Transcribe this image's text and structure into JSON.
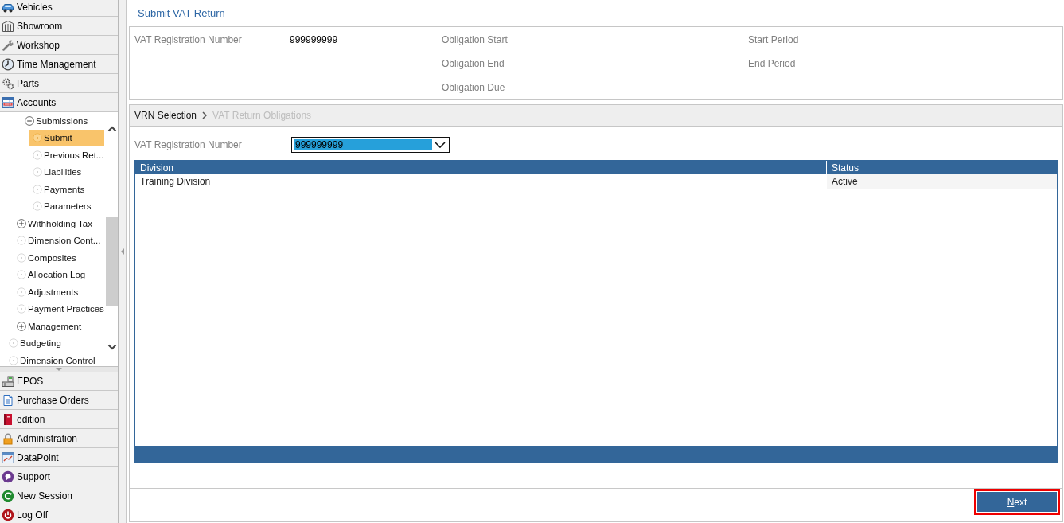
{
  "sidebar": {
    "top_items": [
      {
        "label": "Vehicles"
      },
      {
        "label": "Showroom"
      },
      {
        "label": "Workshop"
      },
      {
        "label": "Time Management"
      },
      {
        "label": "Parts"
      },
      {
        "label": "Accounts"
      }
    ],
    "tree": [
      {
        "children": [
          {
            "children": [
              {
                "label": "Submissions",
                "kind": "group",
                "expanded": true,
                "selected": false,
                "children": [
                  {
                    "label": "Submit",
                    "kind": "leaf",
                    "selected": true
                  },
                  {
                    "label": "Previous Ret...",
                    "kind": "leaf",
                    "selected": false
                  },
                  {
                    "label": "Liabilities",
                    "kind": "leaf",
                    "selected": false
                  },
                  {
                    "label": "Payments",
                    "kind": "leaf",
                    "selected": false
                  },
                  {
                    "label": "Parameters",
                    "kind": "leaf",
                    "selected": false
                  }
                ]
              }
            ]
          },
          {
            "label": "Withholding Tax",
            "kind": "group",
            "expanded": false,
            "selected": false
          },
          {
            "label": "Dimension Cont...",
            "kind": "leaf",
            "selected": false
          },
          {
            "label": "Composites",
            "kind": "leaf",
            "selected": false
          },
          {
            "label": "Allocation Log",
            "kind": "leaf",
            "selected": false
          },
          {
            "label": "Adjustments",
            "kind": "leaf",
            "selected": false
          },
          {
            "label": "Payment Practices",
            "kind": "leaf",
            "selected": false
          },
          {
            "label": "Management",
            "kind": "group",
            "expanded": false,
            "selected": false
          }
        ]
      },
      {
        "label": "Budgeting",
        "kind": "leaf",
        "selected": false
      },
      {
        "label": "Dimension Control",
        "kind": "leaf",
        "selected": false
      }
    ],
    "bottom_items": [
      {
        "label": "EPOS"
      },
      {
        "label": "Purchase Orders"
      },
      {
        "label": "edition"
      },
      {
        "label": "Administration"
      },
      {
        "label": "DataPoint"
      },
      {
        "label": "Support"
      },
      {
        "label": "New Session"
      },
      {
        "label": "Log Off"
      }
    ]
  },
  "main": {
    "title": "Submit VAT Return",
    "summary": {
      "registration": {
        "label": "VAT Registration Number",
        "value": "999999999"
      },
      "obligations": [
        "Obligation Start",
        "Obligation End",
        "Obligation Due"
      ],
      "periods": [
        "Start Period",
        "End Period"
      ]
    },
    "wizard": {
      "steps": [
        {
          "label": "VRN Selection",
          "selected": true
        },
        {
          "label": "VAT Return Obligations",
          "selected": false
        }
      ]
    },
    "vrn_select": {
      "label": "VAT Registration Number",
      "value": "999999999",
      "focused": true
    },
    "table": {
      "columns": [
        "Division",
        "Status"
      ],
      "rows": [
        [
          "Training Division",
          "Active"
        ]
      ]
    },
    "buttons": [
      {
        "label": "Next",
        "highlighted": true
      }
    ]
  }
}
